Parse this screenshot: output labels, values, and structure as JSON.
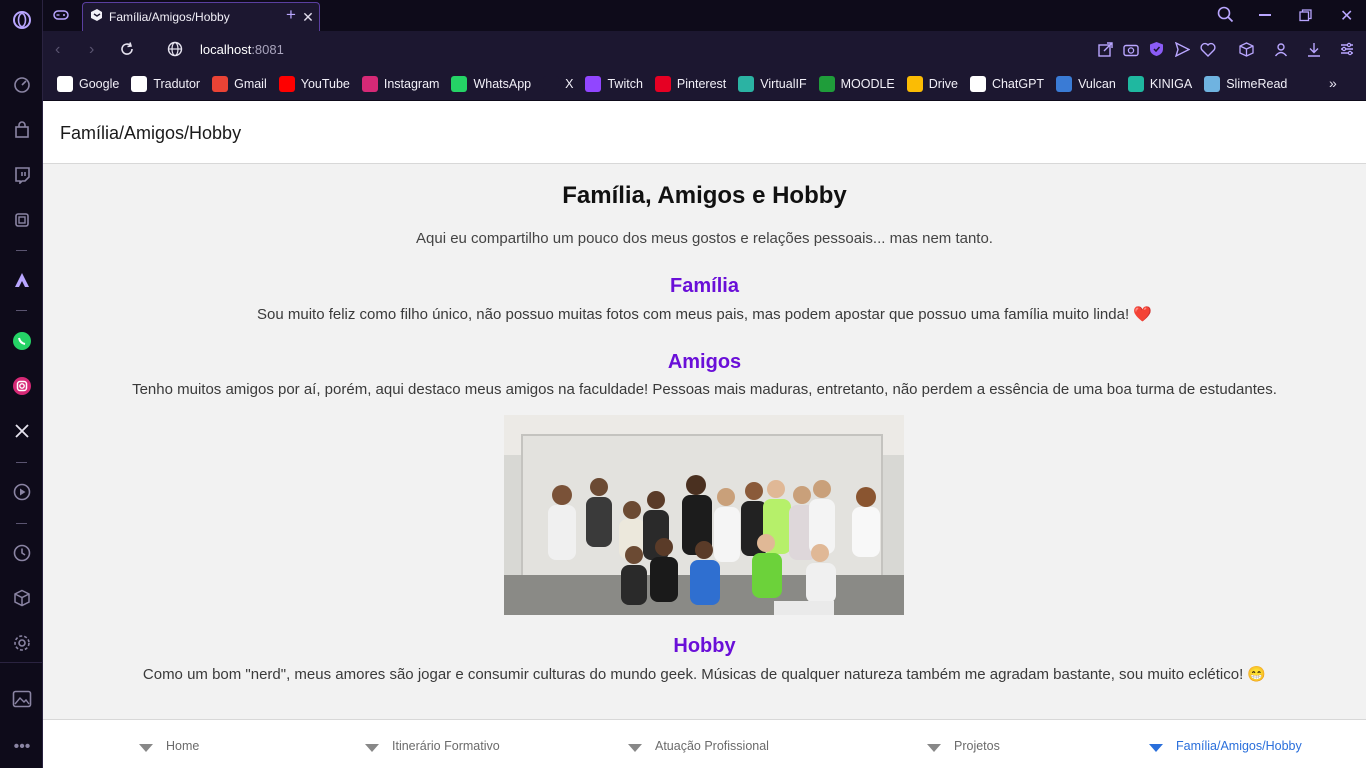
{
  "browser": {
    "tab_title": "Família/Amigos/Hobby",
    "url_host": "localhost",
    "url_port": ":8081",
    "bookmarks": [
      {
        "label": "Google",
        "icon": "google-icon",
        "color": "#ffffff"
      },
      {
        "label": "Tradutor",
        "icon": "google-translate-icon",
        "color": "#ffffff"
      },
      {
        "label": "Gmail",
        "icon": "gmail-icon",
        "color": "#ea4335"
      },
      {
        "label": "YouTube",
        "icon": "youtube-icon",
        "color": "#ff0000"
      },
      {
        "label": "Instagram",
        "icon": "instagram-icon",
        "color": "#d62976"
      },
      {
        "label": "WhatsApp",
        "icon": "whatsapp-icon",
        "color": "#25d366"
      },
      {
        "label": "X",
        "icon": "x-icon",
        "color": "#1c1730"
      },
      {
        "label": "Twitch",
        "icon": "twitch-icon",
        "color": "#9146ff"
      },
      {
        "label": "Pinterest",
        "icon": "pinterest-icon",
        "color": "#e60023"
      },
      {
        "label": "VirtualIF",
        "icon": "virtualif-icon",
        "color": "#2bb3a3"
      },
      {
        "label": "MOODLE",
        "icon": "moodle-icon",
        "color": "#1f9d3a"
      },
      {
        "label": "Drive",
        "icon": "google-drive-icon",
        "color": "#fbbc04"
      },
      {
        "label": "ChatGPT",
        "icon": "chatgpt-icon",
        "color": "#ffffff"
      },
      {
        "label": "Vulcan",
        "icon": "vulcan-icon",
        "color": "#3a7bd5"
      },
      {
        "label": "KINIGA",
        "icon": "kiniga-icon",
        "color": "#1fb8a0"
      },
      {
        "label": "SlimeRead",
        "icon": "slimeread-icon",
        "color": "#6fb3e0"
      }
    ]
  },
  "page": {
    "header_title": "Família/Amigos/Hobby",
    "title": "Família, Amigos e Hobby",
    "intro": "Aqui eu compartilho um pouco dos meus gostos e relações pessoais... mas nem tanto.",
    "sections": [
      {
        "title": "Família",
        "text": "Sou muito feliz como filho único, não possuo muitas fotos com meus pais, mas podem apostar que possuo uma família muito linda! ❤️"
      },
      {
        "title": "Amigos",
        "text": "Tenho muitos amigos por aí, porém, aqui destaco meus amigos na faculdade! Pessoas mais maduras, entretanto, não perdem a essência de uma boa turma de estudantes."
      },
      {
        "title": "Hobby",
        "text": "Como um bom \"nerd\", meus amores são jogar e consumir culturas do mundo geek. Músicas de qualquer natureza também me agradam bastante, sou muito eclético! 😁"
      }
    ],
    "accent_color": "#6a0fd8"
  },
  "bottom_nav": {
    "items": [
      "Home",
      "Itinerário Formativo",
      "Atuação Profissional",
      "Projetos",
      "Família/Amigos/Hobby"
    ],
    "active_index": 4,
    "active_color": "#2a6fdb"
  }
}
